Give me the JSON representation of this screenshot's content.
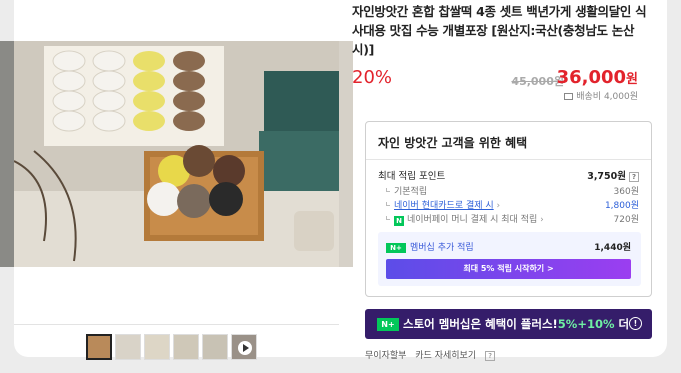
{
  "product": {
    "title": "자인방앗간 혼합 찹쌀떡 4종 셋트 백년가게 생활의달인 식사대용 맛집 수능 개별포장 [원산지:국산(충청남도 논산시)]"
  },
  "price": {
    "discount": "20%",
    "original": "45,000원",
    "final_value": "36,000",
    "final_unit": "원",
    "shipping": "배송비 4,000원"
  },
  "benefit": {
    "header": "자인 방앗간 고객을 위한 혜택",
    "max_points_label": "최대 적립 포인트",
    "max_points_value": "3,750원",
    "rows": [
      {
        "label": "기본적립",
        "value": "360원"
      },
      {
        "label": "네이버 현대카드로 결제 시",
        "value": "1,800원"
      },
      {
        "label": "네이버페이 머니 결제 시 최대 적립",
        "value": "720원"
      }
    ],
    "member_label": "멤버십 추가 적립",
    "member_value": "1,440원",
    "member_button": "최대 5% 적립 시작하기 >"
  },
  "banner": {
    "text": "스토어 멤버십은 혜택이 플러스!",
    "highlight": "5%+10%",
    "suffix": "더"
  },
  "footer": {
    "items": [
      "무이자할부",
      "카드 자세히보기"
    ]
  },
  "icons": {
    "naver_plus": "N+",
    "naver_pay": "N"
  }
}
